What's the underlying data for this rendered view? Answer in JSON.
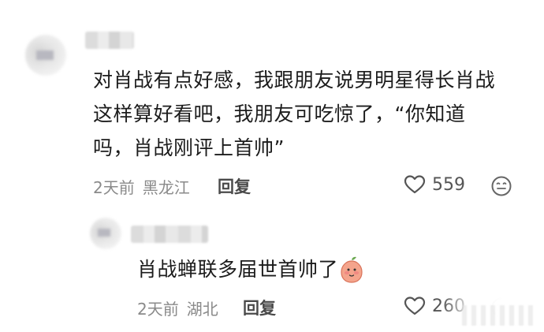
{
  "comments": [
    {
      "text_lines": [
        "对肖战有点好感，我跟朋友说男明星得长肖战",
        "这样算好看吧，我朋友可吃惊了，“你知道",
        "吗，肖战刚评上首帅”"
      ],
      "time": "2天前",
      "location": "黑龙江",
      "reply_label": "回复",
      "likes": "559",
      "like_icon": "heart-outline-icon",
      "emoji_icon": "smiley-face-icon"
    },
    {
      "text": "肖战蝉联多届世首帅了",
      "sticker_icon": "peach-face-sticker-icon",
      "time": "2天前",
      "location": "湖北",
      "reply_label": "回复",
      "likes": "260",
      "like_icon": "heart-outline-icon",
      "emoji_icon": "smiley-face-icon"
    }
  ],
  "colors": {
    "text": "#1c1c1c",
    "meta": "#8a8a8a",
    "reply": "#4a4a4a",
    "background": "#ffffff"
  }
}
